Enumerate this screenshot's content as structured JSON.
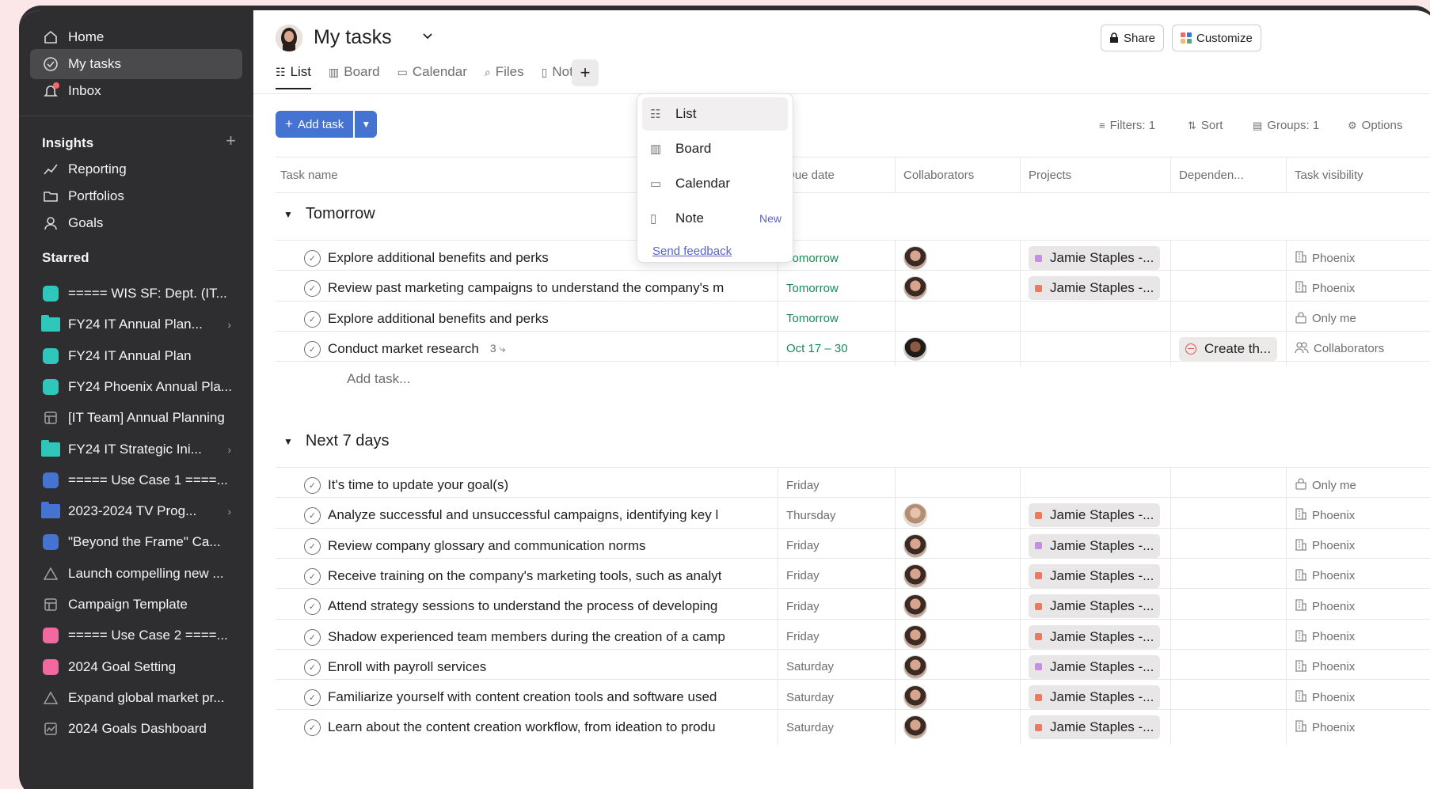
{
  "sidebar": {
    "top": [
      {
        "label": "Home",
        "icon": "home-icon"
      },
      {
        "label": "My tasks",
        "icon": "check-circle-icon"
      },
      {
        "label": "Inbox",
        "icon": "bell-icon"
      }
    ],
    "insights_header": "Insights",
    "insights": [
      {
        "label": "Reporting",
        "icon": "chart-icon"
      },
      {
        "label": "Portfolios",
        "icon": "folder-icon"
      },
      {
        "label": "Goals",
        "icon": "person-icon"
      }
    ],
    "starred_header": "Starred",
    "starred": [
      {
        "label": "===== WIS SF: Dept. (IT...",
        "kind": "square",
        "color": "#2fc7bb"
      },
      {
        "label": "FY24 IT Annual Plan...",
        "kind": "folder",
        "color": "#2fc7bb",
        "chevron": true
      },
      {
        "label": "FY24 IT Annual Plan",
        "kind": "square",
        "color": "#2fc7bb"
      },
      {
        "label": "FY24 Phoenix Annual Pla...",
        "kind": "square",
        "color": "#2fc7bb"
      },
      {
        "label": "[IT Team] Annual Planning",
        "kind": "template",
        "color": "#a2a0a2"
      },
      {
        "label": "FY24 IT Strategic Ini...",
        "kind": "folder",
        "color": "#2fc7bb",
        "chevron": true
      },
      {
        "label": "===== Use Case 1 ====...",
        "kind": "square",
        "color": "#4573d2"
      },
      {
        "label": "2023-2024 TV Prog...",
        "kind": "folder",
        "color": "#4573d2",
        "chevron": true
      },
      {
        "label": "\"Beyond the Frame\" Ca...",
        "kind": "square",
        "color": "#4573d2"
      },
      {
        "label": "Launch compelling new ...",
        "kind": "triangle",
        "color": "#a2a0a2"
      },
      {
        "label": "Campaign Template",
        "kind": "template",
        "color": "#a2a0a2"
      },
      {
        "label": "===== Use Case 2 ====...",
        "kind": "square",
        "color": "#f06a9f"
      },
      {
        "label": "2024 Goal Setting",
        "kind": "square",
        "color": "#f06a9f"
      },
      {
        "label": "Expand global market pr...",
        "kind": "triangle",
        "color": "#a2a0a2"
      },
      {
        "label": "2024 Goals Dashboard",
        "kind": "dashboard",
        "color": "#a2a0a2"
      }
    ]
  },
  "header": {
    "title": "My tasks",
    "share": "Share",
    "customize": "Customize",
    "tabs": [
      "List",
      "Board",
      "Calendar",
      "Files",
      "Note"
    ]
  },
  "toolbar": {
    "add_task": "Add task",
    "filters": "Filters: 1",
    "sort": "Sort",
    "groups": "Groups: 1",
    "options": "Options"
  },
  "columns": [
    "Task name",
    "Due date",
    "Collaborators",
    "Projects",
    "Dependen...",
    "Task visibility"
  ],
  "menu": {
    "items": [
      "List",
      "Board",
      "Calendar",
      "Note"
    ],
    "new_badge": "New",
    "feedback": "Send feedback"
  },
  "groups": [
    {
      "title": "Tomorrow",
      "add_task": "Add task...",
      "tasks": [
        {
          "name": "Explore additional benefits and perks",
          "due": "Tomorrow",
          "due_color": "green",
          "avatar": "a",
          "project": "Jamie Staples -...",
          "proj_color": "#c98de6",
          "dep": "",
          "vis_icon": "building-icon",
          "visibility": "Phoenix"
        },
        {
          "name": "Review past marketing campaigns to understand the company's m",
          "due": "Tomorrow",
          "due_color": "green",
          "avatar": "a",
          "project": "Jamie Staples -...",
          "proj_color": "#f0795c",
          "dep": "",
          "vis_icon": "building-icon",
          "visibility": "Phoenix"
        },
        {
          "name": "Explore additional benefits and perks",
          "due": "Tomorrow",
          "due_color": "green",
          "avatar": "",
          "project": "",
          "proj_color": "",
          "dep": "",
          "vis_icon": "lock-icon",
          "visibility": "Only me"
        },
        {
          "name": "Conduct market research",
          "subtasks": "3",
          "due": "Oct 17 – 30",
          "due_color": "green",
          "avatar": "dark",
          "project": "",
          "proj_color": "",
          "dep": "Create th...",
          "vis_icon": "people-icon",
          "visibility": "Collaborators"
        }
      ]
    },
    {
      "title": "Next 7 days",
      "tasks": [
        {
          "name": "It's time to update your goal(s)",
          "due": "Friday",
          "due_color": "grey",
          "avatar": "",
          "project": "",
          "proj_color": "",
          "dep": "",
          "vis_icon": "lock-icon",
          "visibility": "Only me"
        },
        {
          "name": "Analyze successful and unsuccessful campaigns, identifying key l",
          "due": "Thursday",
          "due_color": "grey",
          "avatar": "light",
          "project": "Jamie Staples -...",
          "proj_color": "#f0795c",
          "dep": "",
          "vis_icon": "building-icon",
          "visibility": "Phoenix"
        },
        {
          "name": "Review company glossary and communication norms",
          "due": "Friday",
          "due_color": "grey",
          "avatar": "a",
          "project": "Jamie Staples -...",
          "proj_color": "#c98de6",
          "dep": "",
          "vis_icon": "building-icon",
          "visibility": "Phoenix"
        },
        {
          "name": "Receive training on the company's marketing tools, such as analyt",
          "due": "Friday",
          "due_color": "grey",
          "avatar": "a",
          "project": "Jamie Staples -...",
          "proj_color": "#f0795c",
          "dep": "",
          "vis_icon": "building-icon",
          "visibility": "Phoenix"
        },
        {
          "name": "Attend strategy sessions to understand the process of developing",
          "due": "Friday",
          "due_color": "grey",
          "avatar": "a",
          "project": "Jamie Staples -...",
          "proj_color": "#f0795c",
          "dep": "",
          "vis_icon": "building-icon",
          "visibility": "Phoenix"
        },
        {
          "name": "Shadow experienced team members during the creation of a camp",
          "due": "Friday",
          "due_color": "grey",
          "avatar": "a",
          "project": "Jamie Staples -...",
          "proj_color": "#f0795c",
          "dep": "",
          "vis_icon": "building-icon",
          "visibility": "Phoenix"
        },
        {
          "name": "Enroll with payroll services",
          "due": "Saturday",
          "due_color": "grey",
          "avatar": "a",
          "project": "Jamie Staples -...",
          "proj_color": "#c98de6",
          "dep": "",
          "vis_icon": "building-icon",
          "visibility": "Phoenix"
        },
        {
          "name": "Familiarize yourself with content creation tools and software used",
          "due": "Saturday",
          "due_color": "grey",
          "avatar": "a",
          "project": "Jamie Staples -...",
          "proj_color": "#f0795c",
          "dep": "",
          "vis_icon": "building-icon",
          "visibility": "Phoenix"
        },
        {
          "name": "Learn about the content creation workflow, from ideation to produ",
          "due": "Saturday",
          "due_color": "grey",
          "avatar": "a",
          "project": "Jamie Staples -...",
          "proj_color": "#f0795c",
          "dep": "",
          "vis_icon": "building-icon",
          "visibility": "Phoenix"
        }
      ]
    }
  ]
}
